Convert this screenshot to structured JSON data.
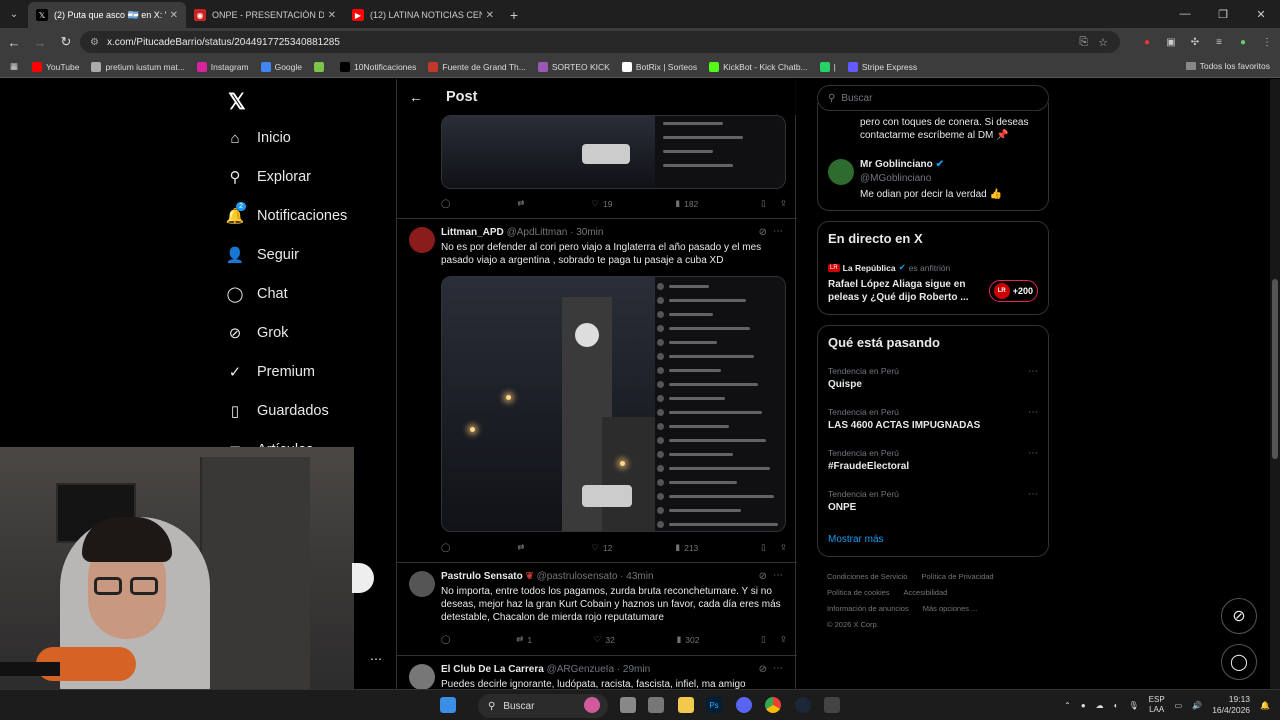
{
  "browser": {
    "tabs": [
      {
        "title": "(2) Puta que asco 🇦🇷 en X: \"@P",
        "fav_color": "#000000",
        "fav_glyph": "𝕏",
        "active": true
      },
      {
        "title": "ONPE - PRESENTACIÓN DE RES",
        "fav_color": "#cc2222",
        "fav_glyph": "◉",
        "active": false
      },
      {
        "title": "(12) LATINA NOTICIAS CENTRA",
        "fav_color": "#ff0000",
        "fav_glyph": "▶",
        "active": false
      }
    ],
    "url": "x.com/PitucadeBarrio/status/2044917725340881285",
    "bookmarks": [
      {
        "label": "YouTube",
        "color": "#ff0000"
      },
      {
        "label": "pretium iustum mat...",
        "color": "#aaaaaa"
      },
      {
        "label": "Instagram",
        "color": "#d6249f"
      },
      {
        "label": "Google",
        "color": "#4285f4"
      },
      {
        "label": "",
        "color": "#7cc34a"
      },
      {
        "label": "10Notificaciones",
        "color": "#000000"
      },
      {
        "label": "Fuente de Grand Th...",
        "color": "#c0392b"
      },
      {
        "label": "SORTEO KICK",
        "color": "#9b59b6"
      },
      {
        "label": "BotRix | Sorteos",
        "color": "#ffffff"
      },
      {
        "label": "KickBot - Kick Chatb...",
        "color": "#53fc18"
      },
      {
        "label": "|",
        "color": "#25d366"
      },
      {
        "label": "Stripe Express",
        "color": "#635bff"
      }
    ],
    "all_bookmarks": "Todos los favoritos"
  },
  "sidebar": {
    "items": [
      {
        "label": "Inicio",
        "icon": "home-icon",
        "glyph": "⌂"
      },
      {
        "label": "Explorar",
        "icon": "search-icon",
        "glyph": "⚲"
      },
      {
        "label": "Notificaciones",
        "icon": "bell-icon",
        "glyph": "🔔",
        "badge": "2"
      },
      {
        "label": "Seguir",
        "icon": "follow-icon",
        "glyph": "👤"
      },
      {
        "label": "Chat",
        "icon": "chat-icon",
        "glyph": "◯"
      },
      {
        "label": "Grok",
        "icon": "grok-icon",
        "glyph": "⊘"
      },
      {
        "label": "Premium",
        "icon": "premium-icon",
        "glyph": "✓"
      },
      {
        "label": "Guardados",
        "icon": "bookmark-icon",
        "glyph": "▯"
      },
      {
        "label": "Artículos",
        "icon": "articles-icon",
        "glyph": "≣"
      }
    ]
  },
  "header": {
    "title": "Post"
  },
  "posts": [
    {
      "replies": "",
      "reposts": "",
      "likes": "19",
      "views": "182"
    },
    {
      "name": "Littman_APD",
      "handle": "@ApdLittman · 30min",
      "text": "No es por defender al cori pero viajo a Inglaterra el año pasado y el mes pasado viajo a argentina , sobrado te paga tu pasaje a cuba XD",
      "avatar_color": "#8a1c1c",
      "replies": "",
      "reposts": "",
      "likes": "12",
      "views": "213"
    },
    {
      "name": "Pastrulo Sensato",
      "handle": "@pastrulosensato · 43min",
      "text": "No importa, entre todos los pagamos, zurda bruta reconchetumare. Y si no deseas, mejor haz la gran Kurt Cobain y haznos un favor, cada día eres más detestable, Chacalon de mierda rojo reputatumare",
      "avatar_color": "#555555",
      "replies": "",
      "reposts": "1",
      "likes": "32",
      "views": "302"
    },
    {
      "name": "El Club De La Carrera",
      "handle": "@ARGenzueIa · 29min",
      "text": "Puedes decirle ignorante, ludópata, racista, fascista, infiel, ma amigo",
      "avatar_color": "#777777"
    }
  ],
  "right": {
    "search_placeholder": "Buscar",
    "prev_bio": "pero con toques de conera. Si deseas contactarme escríbeme al DM 📌",
    "reply_user": {
      "name": "Mr Goblinciano",
      "handle": "@MGoblinciano",
      "text": "Me odian por decir la verdad 👍"
    },
    "live": {
      "title": "En directo en X",
      "host": "La República",
      "host_note": "es anfitrión",
      "text": "Rafael López Aliaga sigue en peleas y ¿Qué dijo Roberto ...",
      "count": "+200"
    },
    "trends": {
      "title": "Qué está pasando",
      "items": [
        {
          "category": "Tendencia en Perú",
          "name": "Quispe"
        },
        {
          "category": "Tendencia en Perú",
          "name": "LAS 4600 ACTAS IMPUGNADAS"
        },
        {
          "category": "Tendencia en Perú",
          "name": "#FraudeElectoral"
        },
        {
          "category": "Tendencia en Perú",
          "name": "ONPE"
        }
      ],
      "show_more": "Mostrar más"
    },
    "footer": [
      "Condiciones de Servicio",
      "Política de Privacidad",
      "Política de cookies",
      "Accesibilidad",
      "Información de anuncios",
      "Más opciones ...",
      "© 2026 X Corp."
    ]
  },
  "taskbar": {
    "search": "Buscar",
    "lang": "ESP",
    "lang2": "LAA",
    "time": "19:13",
    "date": "16/4/2026"
  }
}
